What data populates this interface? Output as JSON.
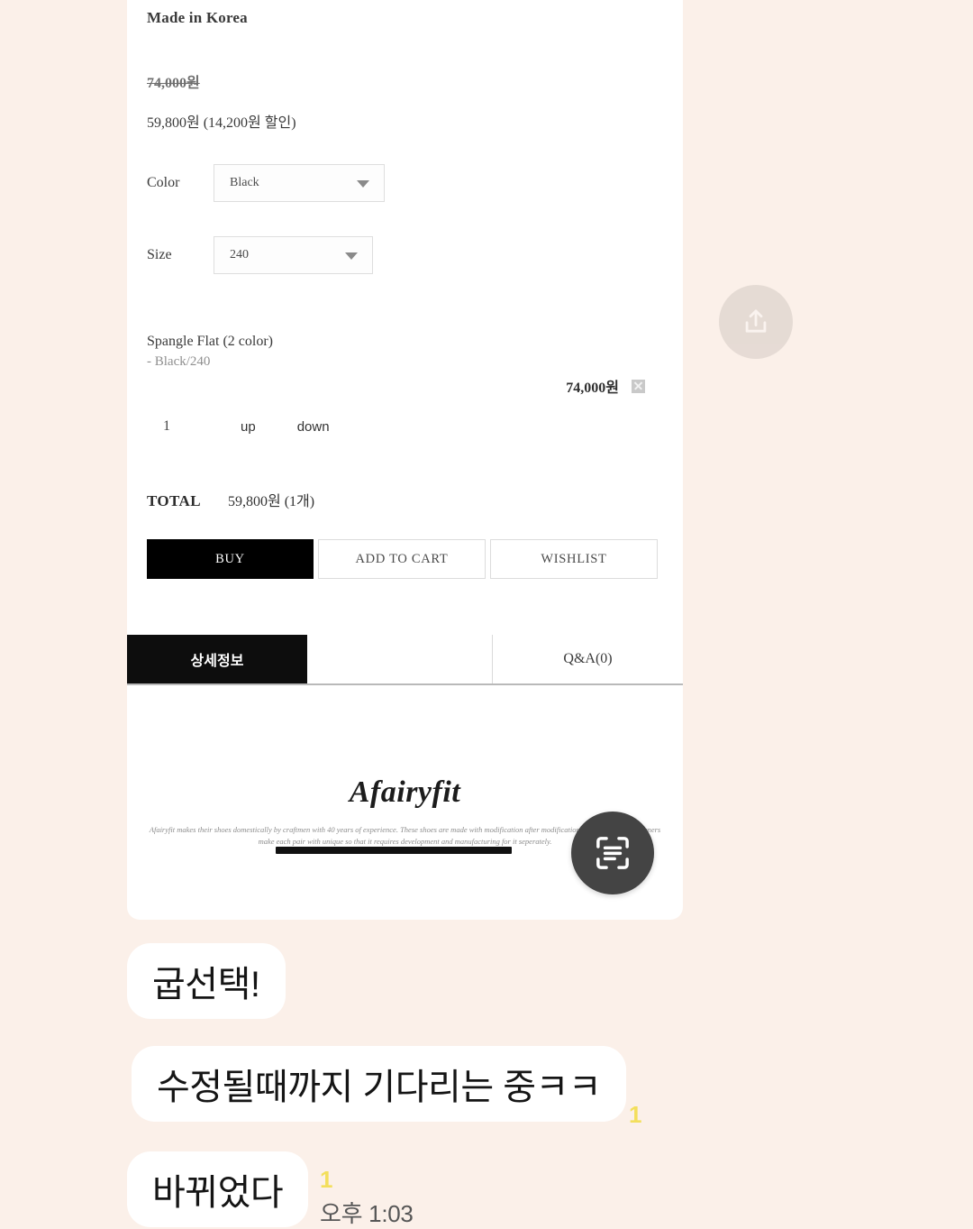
{
  "product": {
    "made_in": "Made in Korea",
    "price_original": "74,000원",
    "price_discounted": "59,800원 (14,200원 할인)",
    "options": [
      {
        "label": "Color",
        "value": "Black"
      },
      {
        "label": "Size",
        "value": "240"
      }
    ],
    "selected_item": {
      "name": "Spangle Flat (2 color)",
      "option": "- Black/240",
      "price": "74,000원",
      "remove_icon": "broken-image-icon",
      "quantity": "1",
      "up_label": "up",
      "down_label": "down"
    },
    "total": {
      "label": "TOTAL",
      "value": "59,800원 (1개)"
    },
    "actions": {
      "buy": "BUY",
      "add_to_cart": "ADD TO CART",
      "wishlist": "WISHLIST"
    },
    "tabs": [
      {
        "label": "상세정보",
        "active": true
      },
      {
        "label": "",
        "active": false
      },
      {
        "label": "Q&A(0)",
        "active": false
      }
    ],
    "brand": {
      "logo": "Afairyfit",
      "copy": "Afairyfit makes their shoes domestically by craftmen with 40 years of experience. These shoes are made with modification after modification by their hands. Designers make each pair with unique so that it requires development and manufacturing for it seperately."
    }
  },
  "overlay": {
    "share_icon": "share-upload-icon",
    "scan_icon": "text-scan-icon"
  },
  "chat": {
    "messages": [
      {
        "text": "굽선택!",
        "unread": ""
      },
      {
        "text": "수정될때까지 기다리는 중ㅋㅋ",
        "unread": "1"
      },
      {
        "text": "바뀌었다",
        "unread": "1"
      }
    ],
    "timestamp": "오후 1:03"
  },
  "colors": {
    "page_background": "#fbf0e9",
    "accent_black": "#0d0d0d",
    "unread_yellow": "#f3df5c",
    "scan_button": "#444444"
  }
}
